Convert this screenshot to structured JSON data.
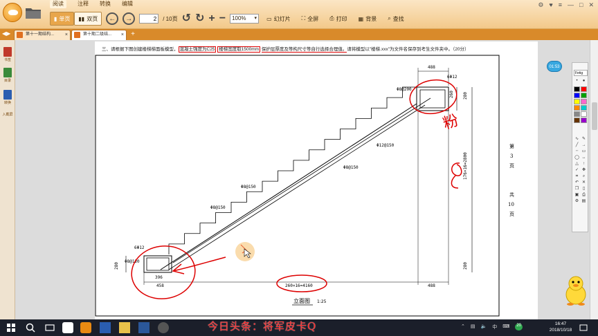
{
  "toolbar": {
    "menu": [
      "阅读",
      "注释",
      "转换",
      "编辑"
    ],
    "single_page": "单页",
    "double_page": "双页",
    "page_current": "2",
    "page_total": "/ 10页",
    "zoom": "100%",
    "slideshow": "幻灯片",
    "fullscreen": "全屏",
    "print": "打印",
    "background": "背景",
    "find": "查找"
  },
  "tabs": [
    {
      "label": "第十一期结构..."
    },
    {
      "label": "第十期二级结..."
    }
  ],
  "sidebar": {
    "items": [
      {
        "label": "书签"
      },
      {
        "label": "目录"
      },
      {
        "label": "转换"
      },
      {
        "label": "入截屏"
      }
    ]
  },
  "document": {
    "instruction_prefix": "三、请根据下图创建楼梯梯面板模型，",
    "box1": "混凝土强度为C25",
    "box2": "楼梯宽度取1500mm",
    "underline": "保护层厚度及等构尺寸等自行选择合理值。",
    "instruction_suffix": "请将模型以\"楼梯.xxx\"为文件名保存到考生文件夹中。（20分）",
    "drawing_title": "立面图",
    "scale": "1:25",
    "side_labels": [
      "第",
      "3",
      "页",
      "共",
      "10",
      "页"
    ],
    "dims": {
      "top_width": "488",
      "top_rebar1": "6Φ12",
      "top_rebar2": "Φ8@200",
      "top_height": "260",
      "diag_main": "Φ12@150",
      "diag_mid": "Φ8@150",
      "diag_low1": "Φ8@150",
      "diag_low2": "Φ8@150",
      "bot_rebar1": "6Φ12",
      "bot_rebar2": "Φ8@120",
      "bot_height": "280",
      "bot_inner": "396",
      "bot_width": "458",
      "run_length": "260×16=4160",
      "right_width": "488",
      "vertical_total": "176×16=2800",
      "right_top_dim": "280",
      "right_bot_dim": "280"
    },
    "handwritten": "粉"
  },
  "annotation_panel": {
    "title": "Fetig",
    "time_bubble": "01:53",
    "colors": [
      "#000000",
      "#ff0000",
      "#0000ff",
      "#00a000",
      "#ffff00",
      "#ff66cc",
      "#ff8800",
      "#00cccc",
      "#888888",
      "#ffffff",
      "#663300",
      "#9900cc"
    ]
  },
  "taskbar": {
    "watermark": "今日头条：将军皮卡Q",
    "time": "16:47",
    "date": "2018/10/18",
    "ime": "中",
    "battery": "20"
  }
}
